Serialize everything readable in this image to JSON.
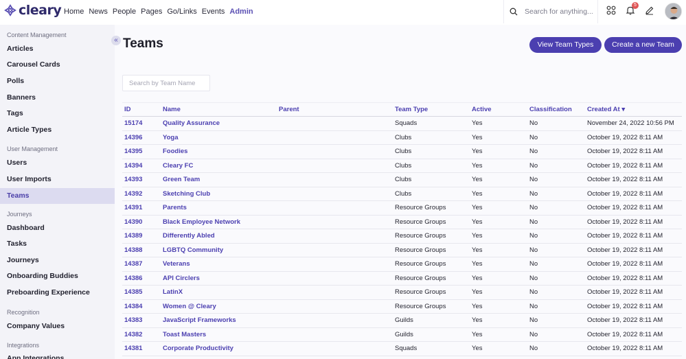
{
  "app": {
    "logo_text": "cleary",
    "nav": [
      "Home",
      "News",
      "People",
      "Pages",
      "Go/Links",
      "Events",
      "Admin"
    ],
    "active_nav": "Admin",
    "search_placeholder": "Search for anything...",
    "notification_count": "5"
  },
  "sidebar": {
    "sections": [
      {
        "title": "Content Management",
        "items": [
          "Articles",
          "Carousel Cards",
          "Polls",
          "Banners",
          "Tags",
          "Article Types"
        ]
      },
      {
        "title": "User Management",
        "items": [
          "Users",
          "User Imports",
          "Teams"
        ]
      },
      {
        "title": "Journeys",
        "items": [
          "Dashboard",
          "Tasks",
          "Journeys",
          "Onboarding Buddies",
          "Preboarding Experience"
        ]
      },
      {
        "title": "Recognition",
        "items": [
          "Company Values"
        ]
      },
      {
        "title": "Integrations",
        "items": [
          "App Integrations"
        ]
      }
    ],
    "selected": "Teams"
  },
  "main": {
    "title": "Teams",
    "view_types_label": "View Team Types",
    "create_label": "Create a new Team",
    "search_placeholder": "Search by Team Name",
    "columns": [
      "ID",
      "Name",
      "Parent",
      "Team Type",
      "Active",
      "Classification",
      "Created At ▾"
    ],
    "rows": [
      [
        "15174",
        "Quality Assurance",
        "",
        "Squads",
        "Yes",
        "No",
        "November 24, 2022 10:56 PM"
      ],
      [
        "14396",
        "Yoga",
        "",
        "Clubs",
        "Yes",
        "No",
        "October 19, 2022 8:11 AM"
      ],
      [
        "14395",
        "Foodies",
        "",
        "Clubs",
        "Yes",
        "No",
        "October 19, 2022 8:11 AM"
      ],
      [
        "14394",
        "Cleary FC",
        "",
        "Clubs",
        "Yes",
        "No",
        "October 19, 2022 8:11 AM"
      ],
      [
        "14393",
        "Green Team",
        "",
        "Clubs",
        "Yes",
        "No",
        "October 19, 2022 8:11 AM"
      ],
      [
        "14392",
        "Sketching Club",
        "",
        "Clubs",
        "Yes",
        "No",
        "October 19, 2022 8:11 AM"
      ],
      [
        "14391",
        "Parents",
        "",
        "Resource Groups",
        "Yes",
        "No",
        "October 19, 2022 8:11 AM"
      ],
      [
        "14390",
        "Black Employee Network",
        "",
        "Resource Groups",
        "Yes",
        "No",
        "October 19, 2022 8:11 AM"
      ],
      [
        "14389",
        "Differently Abled",
        "",
        "Resource Groups",
        "Yes",
        "No",
        "October 19, 2022 8:11 AM"
      ],
      [
        "14388",
        "LGBTQ Community",
        "",
        "Resource Groups",
        "Yes",
        "No",
        "October 19, 2022 8:11 AM"
      ],
      [
        "14387",
        "Veterans",
        "",
        "Resource Groups",
        "Yes",
        "No",
        "October 19, 2022 8:11 AM"
      ],
      [
        "14386",
        "API Circlers",
        "",
        "Resource Groups",
        "Yes",
        "No",
        "October 19, 2022 8:11 AM"
      ],
      [
        "14385",
        "LatinX",
        "",
        "Resource Groups",
        "Yes",
        "No",
        "October 19, 2022 8:11 AM"
      ],
      [
        "14384",
        "Women @ Cleary",
        "",
        "Resource Groups",
        "Yes",
        "No",
        "October 19, 2022 8:11 AM"
      ],
      [
        "14383",
        "JavaScript Frameworks",
        "",
        "Guilds",
        "Yes",
        "No",
        "October 19, 2022 8:11 AM"
      ],
      [
        "14382",
        "Toast Masters",
        "",
        "Guilds",
        "Yes",
        "No",
        "October 19, 2022 8:11 AM"
      ],
      [
        "14381",
        "Corporate Productivity",
        "",
        "Squads",
        "Yes",
        "No",
        "October 19, 2022 8:11 AM"
      ]
    ]
  },
  "colors": {
    "accent": "#4b3fb0",
    "sidebar_bg": "#f3f3f8",
    "selected_bg": "#dcdbf0"
  },
  "icons": [
    "cleary-logo-icon",
    "search-icon",
    "apps-grid-icon",
    "bell-icon",
    "pencil-icon",
    "collapse-chevrons-icon"
  ]
}
